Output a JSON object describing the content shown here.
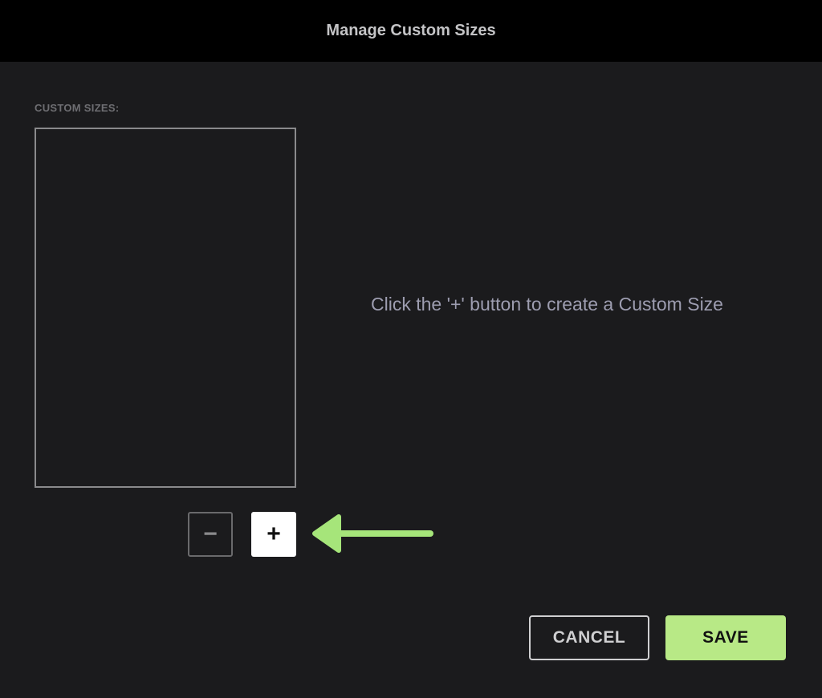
{
  "header": {
    "title": "Manage Custom Sizes"
  },
  "custom_sizes": {
    "label": "CUSTOM SIZES:",
    "items": []
  },
  "hint": "Click the '+' button to create a Custom Size",
  "controls": {
    "remove_label": "−",
    "add_label": "+"
  },
  "footer": {
    "cancel_label": "CANCEL",
    "save_label": "SAVE"
  },
  "colors": {
    "accent": "#b8e986",
    "arrow": "#a6e57a"
  }
}
